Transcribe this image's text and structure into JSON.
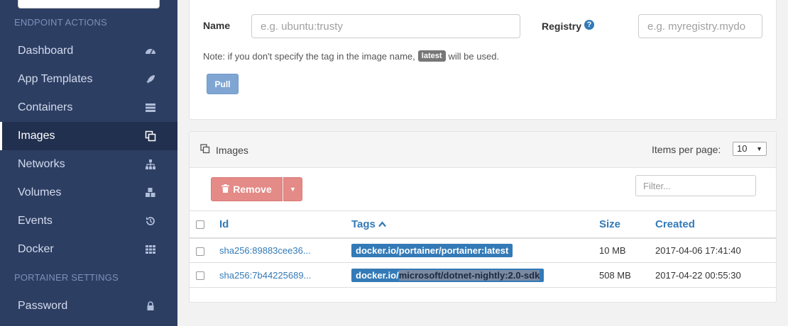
{
  "sidebar": {
    "section_endpoint": "ENDPOINT ACTIONS",
    "section_portainer": "PORTAINER SETTINGS",
    "items": [
      {
        "label": "Dashboard",
        "icon": "tachometer-icon"
      },
      {
        "label": "App Templates",
        "icon": "rocket-icon"
      },
      {
        "label": "Containers",
        "icon": "server-icon"
      },
      {
        "label": "Images",
        "icon": "clone-icon"
      },
      {
        "label": "Networks",
        "icon": "sitemap-icon"
      },
      {
        "label": "Volumes",
        "icon": "cubes-icon"
      },
      {
        "label": "Events",
        "icon": "history-icon"
      },
      {
        "label": "Docker",
        "icon": "th-icon"
      }
    ],
    "settings_items": [
      {
        "label": "Password",
        "icon": "lock-icon"
      }
    ]
  },
  "pull_form": {
    "name_label": "Name",
    "name_placeholder": "e.g. ubuntu:trusty",
    "registry_label": "Registry",
    "registry_placeholder": "e.g. myregistry.mydo",
    "note_prefix": "Note: if you don't specify the tag in the image name,",
    "note_tag": "latest",
    "note_suffix": "will be used.",
    "pull_label": "Pull"
  },
  "images_panel": {
    "title": "Images",
    "items_per_page_label": "Items per page:",
    "items_per_page_value": "10",
    "remove_label": "Remove",
    "filter_placeholder": "Filter...",
    "columns": {
      "id": "Id",
      "tags": "Tags",
      "size": "Size",
      "created": "Created"
    },
    "rows": [
      {
        "id": "sha256:89883cee36...",
        "tag_prefix": "docker.io/",
        "tag_rest": "portainer/portainer:latest",
        "size": "10 MB",
        "created": "2017-04-06 17:41:40"
      },
      {
        "id": "sha256:7b44225689...",
        "tag_prefix": "docker.io/",
        "tag_rest": "microsoft/dotnet-nightly:2.0-sdk",
        "size": "508 MB",
        "created": "2017-04-22 00:55:30"
      }
    ]
  }
}
